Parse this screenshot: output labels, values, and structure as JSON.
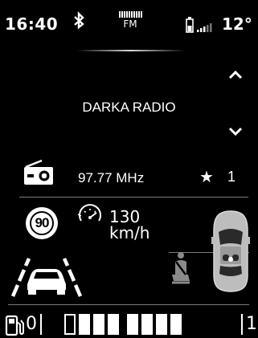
{
  "status": {
    "time": "16:40",
    "band": "FM",
    "temperature": "12°",
    "icons": [
      "bluetooth-icon",
      "battery-icon",
      "signal-strength-icon"
    ]
  },
  "radio": {
    "station_name": "DARKA RADIO",
    "frequency": "97.77 MHz",
    "preset_number": "1",
    "icons": [
      "radio-icon",
      "favorite-star-icon",
      "chevron-up-icon",
      "chevron-down-icon"
    ]
  },
  "driving": {
    "speed_limit": "90",
    "cruise_speed": "130",
    "cruise_unit": "km/h",
    "icons": [
      "speed-limit-sign",
      "speedometer-icon",
      "lane-assist-icon",
      "car-top-view-icon",
      "seatbelt-warning-icon"
    ]
  },
  "fuel": {
    "min_label": "0",
    "max_label": "1",
    "segments_total": 8,
    "segments_filled": 7,
    "icons": [
      "fuel-pump-icon"
    ]
  },
  "colors": {
    "background": "#000000",
    "foreground": "#ffffff",
    "dim": "#7d7d7d"
  }
}
